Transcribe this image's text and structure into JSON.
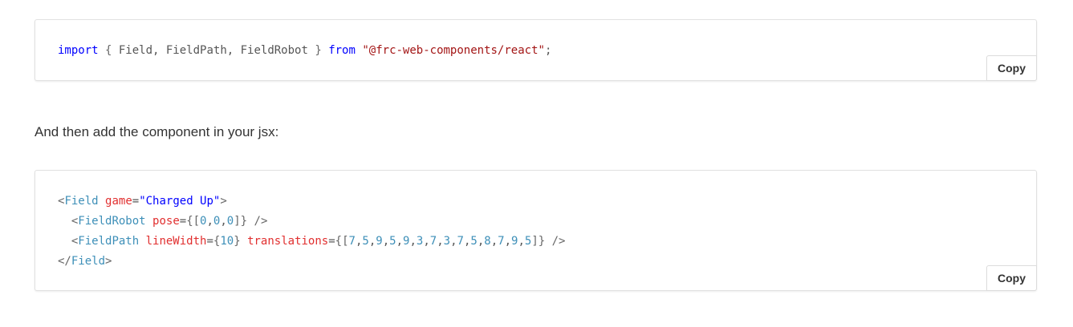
{
  "code_blocks": [
    {
      "lines": [
        [
          {
            "t": "import",
            "c": "kw"
          },
          {
            "t": " ",
            "c": ""
          },
          {
            "t": "{",
            "c": "punc"
          },
          {
            "t": " Field, FieldPath, FieldRobot ",
            "c": ""
          },
          {
            "t": "}",
            "c": "punc"
          },
          {
            "t": " ",
            "c": ""
          },
          {
            "t": "from",
            "c": "kw"
          },
          {
            "t": " ",
            "c": ""
          },
          {
            "t": "\"@frc-web-components/react\"",
            "c": "str"
          },
          {
            "t": ";",
            "c": ""
          }
        ]
      ],
      "copy_label": "Copy"
    },
    {
      "lines": [
        [
          {
            "t": "<",
            "c": "punc"
          },
          {
            "t": "Field",
            "c": "tag"
          },
          {
            "t": " ",
            "c": ""
          },
          {
            "t": "game",
            "c": "attr"
          },
          {
            "t": "=",
            "c": ""
          },
          {
            "t": "\"Charged Up\"",
            "c": "kw"
          },
          {
            "t": ">",
            "c": "punc"
          }
        ],
        [
          {
            "t": "  ",
            "c": ""
          },
          {
            "t": "<",
            "c": "punc"
          },
          {
            "t": "FieldRobot",
            "c": "tag"
          },
          {
            "t": " ",
            "c": ""
          },
          {
            "t": "pose",
            "c": "attr"
          },
          {
            "t": "=",
            "c": ""
          },
          {
            "t": "{[",
            "c": "punc"
          },
          {
            "t": "0",
            "c": "num"
          },
          {
            "t": ",",
            "c": ""
          },
          {
            "t": "0",
            "c": "num"
          },
          {
            "t": ",",
            "c": ""
          },
          {
            "t": "0",
            "c": "num"
          },
          {
            "t": "]}",
            "c": "punc"
          },
          {
            "t": " />",
            "c": "punc"
          }
        ],
        [
          {
            "t": "  ",
            "c": ""
          },
          {
            "t": "<",
            "c": "punc"
          },
          {
            "t": "FieldPath",
            "c": "tag"
          },
          {
            "t": " ",
            "c": ""
          },
          {
            "t": "lineWidth",
            "c": "attr"
          },
          {
            "t": "=",
            "c": ""
          },
          {
            "t": "{",
            "c": "punc"
          },
          {
            "t": "10",
            "c": "num"
          },
          {
            "t": "}",
            "c": "punc"
          },
          {
            "t": " ",
            "c": ""
          },
          {
            "t": "translations",
            "c": "attr"
          },
          {
            "t": "=",
            "c": ""
          },
          {
            "t": "{[",
            "c": "punc"
          },
          {
            "t": "7",
            "c": "num"
          },
          {
            "t": ",",
            "c": ""
          },
          {
            "t": "5",
            "c": "num"
          },
          {
            "t": ",",
            "c": ""
          },
          {
            "t": "9",
            "c": "num"
          },
          {
            "t": ",",
            "c": ""
          },
          {
            "t": "5",
            "c": "num"
          },
          {
            "t": ",",
            "c": ""
          },
          {
            "t": "9",
            "c": "num"
          },
          {
            "t": ",",
            "c": ""
          },
          {
            "t": "3",
            "c": "num"
          },
          {
            "t": ",",
            "c": ""
          },
          {
            "t": "7",
            "c": "num"
          },
          {
            "t": ",",
            "c": ""
          },
          {
            "t": "3",
            "c": "num"
          },
          {
            "t": ",",
            "c": ""
          },
          {
            "t": "7",
            "c": "num"
          },
          {
            "t": ",",
            "c": ""
          },
          {
            "t": "5",
            "c": "num"
          },
          {
            "t": ",",
            "c": ""
          },
          {
            "t": "8",
            "c": "num"
          },
          {
            "t": ",",
            "c": ""
          },
          {
            "t": "7",
            "c": "num"
          },
          {
            "t": ",",
            "c": ""
          },
          {
            "t": "9",
            "c": "num"
          },
          {
            "t": ",",
            "c": ""
          },
          {
            "t": "5",
            "c": "num"
          },
          {
            "t": "]}",
            "c": "punc"
          },
          {
            "t": " />",
            "c": "punc"
          }
        ],
        [
          {
            "t": "</",
            "c": "punc"
          },
          {
            "t": "Field",
            "c": "tag"
          },
          {
            "t": ">",
            "c": "punc"
          }
        ]
      ],
      "copy_label": "Copy"
    }
  ],
  "prose": {
    "text": "And then add the component in your jsx:"
  },
  "colors": {
    "keyword": "#0000ff",
    "string": "#a31515",
    "tag": "#3d8fb8",
    "attribute": "#e12f2f",
    "number": "#3d8fb8"
  }
}
